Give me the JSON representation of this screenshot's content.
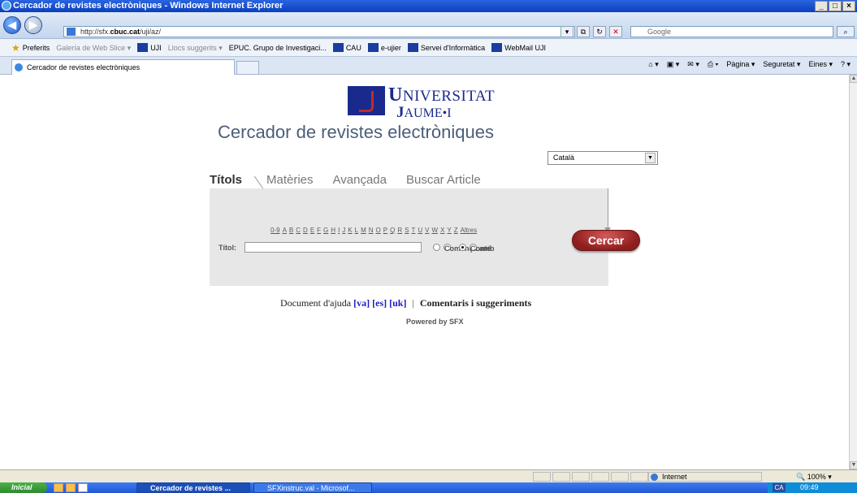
{
  "window": {
    "title": "Cercador de revistes electròniques - Windows Internet Explorer"
  },
  "address": {
    "url_prefix": "http://sfx.",
    "url_host": "cbuc.cat",
    "url_path": "/uji/az/",
    "search_placeholder": "Google"
  },
  "favorites": {
    "label": "Preferits",
    "items": [
      "Galería de Web Slice ▾",
      "UJI",
      "Llocs suggerits ▾",
      "EPUC. Grupo de Investigaci...",
      "CAU",
      "e-ujier",
      "Servei d'Informàtica",
      "WebMail UJI"
    ]
  },
  "tab": {
    "label": "Cercador de revistes electròniques"
  },
  "commandbar": {
    "page": "Pàgina ▾",
    "safety": "Seguretat ▾",
    "tools": "Eines ▾"
  },
  "logo": {
    "line1_first": "U",
    "line1_rest": "NIVERSITAT",
    "line2_first": "J",
    "line2_rest": "AUME•I"
  },
  "page": {
    "title": "Cercador de revistes electròniques"
  },
  "language": {
    "selected": "Català"
  },
  "tabs": [
    {
      "label": "Títols"
    },
    {
      "label": "Matèries"
    },
    {
      "label": "Avançada"
    },
    {
      "label": "Buscar Article"
    }
  ],
  "alphabet": [
    "0-9",
    "A",
    "B",
    "C",
    "D",
    "E",
    "F",
    "G",
    "H",
    "I",
    "J",
    "K",
    "L",
    "M",
    "N",
    "O",
    "P",
    "Q",
    "R",
    "S",
    "T",
    "U",
    "V",
    "W",
    "X",
    "Y",
    "Z",
    "Altres"
  ],
  "search": {
    "label": "Títol:",
    "value": "",
    "option_begins": "Comença amb",
    "option_contains": "Conté",
    "button": "Cercar"
  },
  "help": {
    "text": "Document d'ajuda",
    "va": "[va]",
    "es": "[es]",
    "uk": "[uk]",
    "sep": "|",
    "comments": "Comentaris i suggeriments"
  },
  "powered": "Powered by SFX",
  "status": {
    "zone": "Internet",
    "zoom": "100%"
  },
  "taskbar": {
    "start": "Inicial",
    "task1": "Cercador de revistes ...",
    "task2": "SFXinstruc.val - Microsof...",
    "lang": "CA",
    "clock": "09:49"
  }
}
